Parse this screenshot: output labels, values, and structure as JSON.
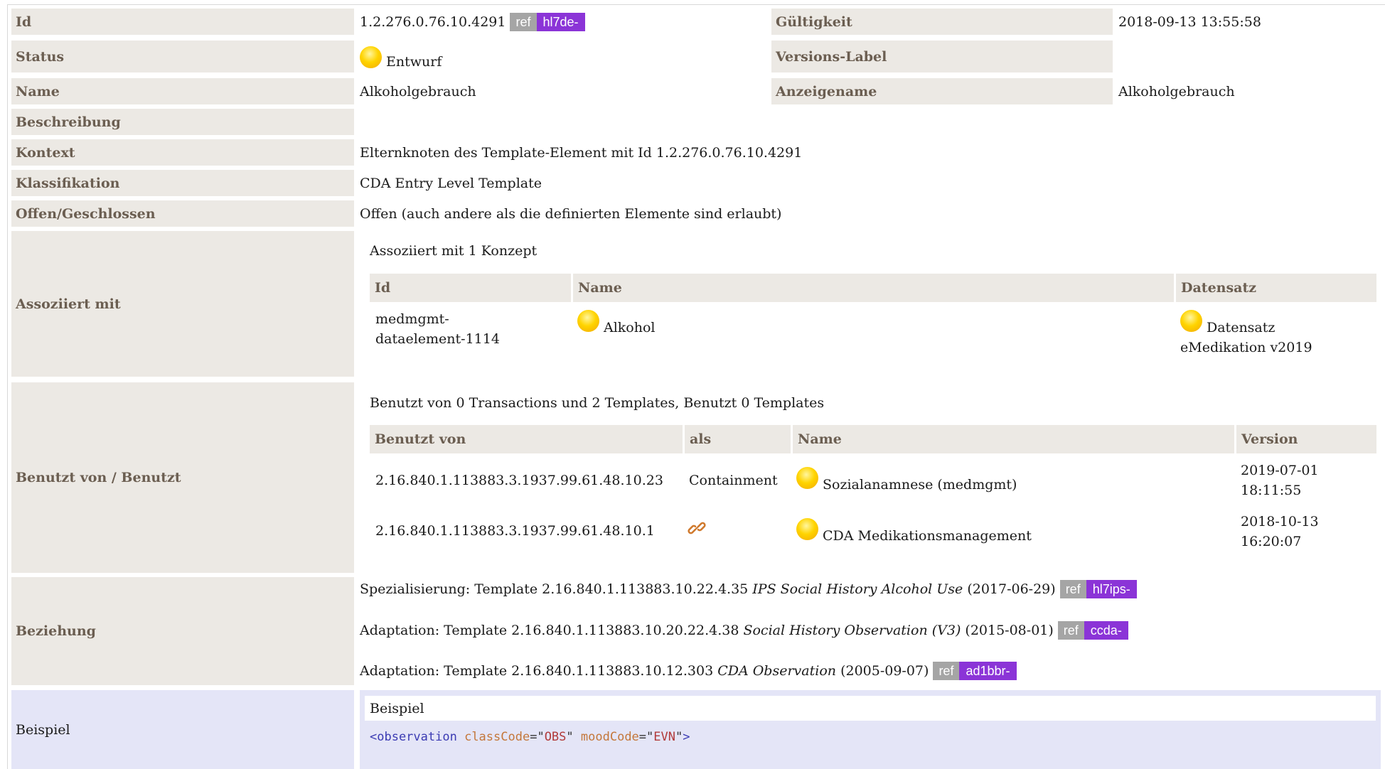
{
  "rows": {
    "id": {
      "label": "Id",
      "value": "1.2.276.0.76.10.4291",
      "ref": "ref",
      "prefix": "hl7de-"
    },
    "gueltigkeit": {
      "label": "Gültigkeit",
      "value": "2018-09-13 13:55:58"
    },
    "status": {
      "label": "Status",
      "value": "Entwurf"
    },
    "versions_label": {
      "label": "Versions-Label",
      "value": ""
    },
    "name": {
      "label": "Name",
      "value": "Alkoholgebrauch"
    },
    "anzeigename": {
      "label": "Anzeigename",
      "value": "Alkoholgebrauch"
    },
    "beschreibung": {
      "label": "Beschreibung",
      "value": ""
    },
    "kontext": {
      "label": "Kontext",
      "value": "Elternknoten des Template-Element mit Id 1.2.276.0.76.10.4291"
    },
    "klassifikation": {
      "label": "Klassifikation",
      "value": "CDA Entry Level Template"
    },
    "offen": {
      "label": "Offen/Geschlossen",
      "value": "Offen (auch andere als die definierten Elemente sind erlaubt)"
    }
  },
  "assoziiert": {
    "label": "Assoziiert mit",
    "summary": "Assoziiert mit 1 Konzept",
    "headers": {
      "id": "Id",
      "name": "Name",
      "datensatz": "Datensatz"
    },
    "row": {
      "id_line1": "medmgmt-",
      "id_line2": "dataelement-1114",
      "name": "Alkohol",
      "datensatz_line1": "Datensatz",
      "datensatz_line2": "eMedikation v2019"
    }
  },
  "benutzt": {
    "label": "Benutzt von / Benutzt",
    "summary": "Benutzt von 0 Transactions und 2 Templates, Benutzt 0 Templates",
    "headers": {
      "von": "Benutzt von",
      "als": "als",
      "name": "Name",
      "version": "Version"
    },
    "rows": [
      {
        "von": "2.16.840.1.113883.3.1937.99.61.48.10.23",
        "als": "Containment",
        "name": "Sozialanamnese (medmgmt)",
        "version_date": "2019-07-01",
        "version_time": "18:11:55"
      },
      {
        "von": "2.16.840.1.113883.3.1937.99.61.48.10.1",
        "als_icon": "link-icon",
        "name": "CDA Medikationsmanagement",
        "version_date": "2018-10-13",
        "version_time": "16:20:07"
      }
    ]
  },
  "beziehung": {
    "label": "Beziehung",
    "items": [
      {
        "prefix": "Spezialisierung: Template 2.16.840.1.113883.10.22.4.35",
        "title": "IPS Social History Alcohol Use",
        "date": "(2017-06-29)",
        "ref": "ref",
        "badge": "hl7ips-"
      },
      {
        "prefix": "Adaptation: Template 2.16.840.1.113883.10.20.22.4.38",
        "title": "Social History Observation (V3)",
        "date": "(2015-08-01)",
        "ref": "ref",
        "badge": "ccda-"
      },
      {
        "prefix": "Adaptation: Template 2.16.840.1.113883.10.12.303",
        "title": "CDA Observation",
        "date": "(2005-09-07)",
        "ref": "ref",
        "badge": "ad1bbr-"
      }
    ]
  },
  "beispiel": {
    "label": "Beispiel",
    "title": "Beispiel",
    "code": {
      "tag_open": "<observation",
      "attr1": "classCode",
      "eq1": "=\"",
      "val1": "OBS",
      "q1": "\"",
      "attr2": "moodCode",
      "eq2": "=\"",
      "val2": "EVN",
      "q2": "\"",
      "tag_close": ">"
    }
  },
  "colors": {
    "label_bg": "#ece9e4",
    "label_text": "#6b5e51",
    "badge_ref": "#a5a5a5",
    "badge_prefix": "#8b34d7",
    "example_bg": "#e4e5f7"
  }
}
